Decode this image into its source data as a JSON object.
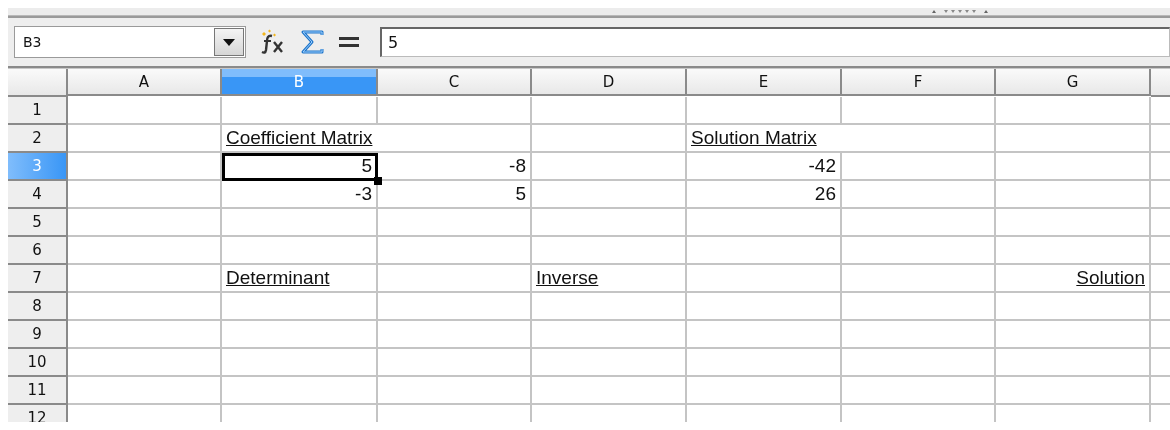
{
  "name_box": {
    "value": "B3"
  },
  "formula_bar": {
    "value": "5"
  },
  "columns": [
    {
      "label": "A",
      "selected": false
    },
    {
      "label": "B",
      "selected": true
    },
    {
      "label": "C",
      "selected": false
    },
    {
      "label": "D",
      "selected": false
    },
    {
      "label": "E",
      "selected": false
    },
    {
      "label": "F",
      "selected": false
    },
    {
      "label": "G",
      "selected": false
    }
  ],
  "rows": [
    {
      "label": "1",
      "selected": false,
      "cells": [
        {
          "selected": false
        },
        {
          "selected": false
        },
        {
          "selected": false
        },
        {
          "selected": false
        },
        {
          "selected": false
        },
        {
          "selected": false
        },
        {
          "selected": false
        }
      ]
    },
    {
      "label": "2",
      "selected": false,
      "cells": [
        {
          "selected": false
        },
        {
          "selected": false,
          "kind": "heading",
          "right_aligned": false,
          "text": "Coefficient Matrix"
        },
        {
          "selected": false
        },
        {
          "selected": false
        },
        {
          "selected": false,
          "kind": "heading",
          "right_aligned": false,
          "text": "Solution Matrix"
        },
        {
          "selected": false
        },
        {
          "selected": false
        }
      ]
    },
    {
      "label": "3",
      "selected": true,
      "cells": [
        {
          "selected": false
        },
        {
          "selected": true,
          "kind": "number",
          "text": "5"
        },
        {
          "selected": false,
          "kind": "number",
          "text": "-8"
        },
        {
          "selected": false
        },
        {
          "selected": false,
          "kind": "number",
          "text": "-42"
        },
        {
          "selected": false
        },
        {
          "selected": false
        }
      ]
    },
    {
      "label": "4",
      "selected": false,
      "cells": [
        {
          "selected": false
        },
        {
          "selected": false,
          "kind": "number",
          "text": "-3"
        },
        {
          "selected": false,
          "kind": "number",
          "text": "5"
        },
        {
          "selected": false
        },
        {
          "selected": false,
          "kind": "number",
          "text": "26"
        },
        {
          "selected": false
        },
        {
          "selected": false
        }
      ]
    },
    {
      "label": "5",
      "selected": false,
      "cells": [
        {
          "selected": false
        },
        {
          "selected": false
        },
        {
          "selected": false
        },
        {
          "selected": false
        },
        {
          "selected": false
        },
        {
          "selected": false
        },
        {
          "selected": false
        }
      ]
    },
    {
      "label": "6",
      "selected": false,
      "cells": [
        {
          "selected": false
        },
        {
          "selected": false
        },
        {
          "selected": false
        },
        {
          "selected": false
        },
        {
          "selected": false
        },
        {
          "selected": false
        },
        {
          "selected": false
        }
      ]
    },
    {
      "label": "7",
      "selected": false,
      "cells": [
        {
          "selected": false
        },
        {
          "selected": false,
          "kind": "heading",
          "right_aligned": false,
          "text": "Determinant"
        },
        {
          "selected": false
        },
        {
          "selected": false,
          "kind": "heading",
          "right_aligned": false,
          "text": "Inverse"
        },
        {
          "selected": false
        },
        {
          "selected": false
        },
        {
          "selected": false,
          "kind": "heading",
          "right_aligned": true,
          "text": "Solution"
        }
      ]
    },
    {
      "label": "8",
      "selected": false,
      "cells": [
        {
          "selected": false
        },
        {
          "selected": false
        },
        {
          "selected": false
        },
        {
          "selected": false
        },
        {
          "selected": false
        },
        {
          "selected": false
        },
        {
          "selected": false
        }
      ]
    },
    {
      "label": "9",
      "selected": false,
      "cells": [
        {
          "selected": false
        },
        {
          "selected": false
        },
        {
          "selected": false
        },
        {
          "selected": false
        },
        {
          "selected": false
        },
        {
          "selected": false
        },
        {
          "selected": false
        }
      ]
    },
    {
      "label": "10",
      "selected": false,
      "cells": [
        {
          "selected": false
        },
        {
          "selected": false
        },
        {
          "selected": false
        },
        {
          "selected": false
        },
        {
          "selected": false
        },
        {
          "selected": false
        },
        {
          "selected": false
        }
      ]
    },
    {
      "label": "11",
      "selected": false,
      "cells": [
        {
          "selected": false
        },
        {
          "selected": false
        },
        {
          "selected": false
        },
        {
          "selected": false
        },
        {
          "selected": false
        },
        {
          "selected": false
        },
        {
          "selected": false
        }
      ]
    },
    {
      "label": "12",
      "selected": false,
      "cells": [
        {
          "selected": false
        },
        {
          "selected": false
        },
        {
          "selected": false
        },
        {
          "selected": false
        },
        {
          "selected": false
        },
        {
          "selected": false
        },
        {
          "selected": false
        }
      ]
    }
  ]
}
